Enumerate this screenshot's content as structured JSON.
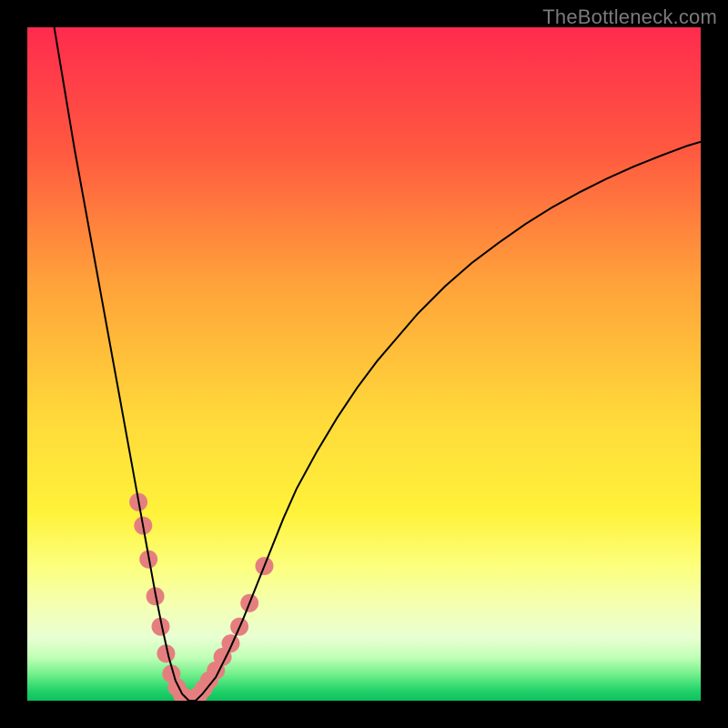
{
  "watermark": "TheBottleneck.com",
  "chart_data": {
    "type": "line",
    "title": "",
    "xlabel": "",
    "ylabel": "",
    "xlim": [
      0,
      100
    ],
    "ylim": [
      0,
      100
    ],
    "grid": false,
    "legend": false,
    "background_gradient_stops": [
      {
        "offset": 0.0,
        "color": "#ff2b4e"
      },
      {
        "offset": 0.18,
        "color": "#ff5840"
      },
      {
        "offset": 0.38,
        "color": "#ffa23a"
      },
      {
        "offset": 0.58,
        "color": "#ffd93a"
      },
      {
        "offset": 0.72,
        "color": "#fff23a"
      },
      {
        "offset": 0.8,
        "color": "#fcff7d"
      },
      {
        "offset": 0.86,
        "color": "#f4ffb3"
      },
      {
        "offset": 0.905,
        "color": "#e9ffd2"
      },
      {
        "offset": 0.935,
        "color": "#c3ffb8"
      },
      {
        "offset": 0.96,
        "color": "#74f08c"
      },
      {
        "offset": 0.985,
        "color": "#22d36a"
      },
      {
        "offset": 1.0,
        "color": "#0cc05e"
      }
    ],
    "series": [
      {
        "name": "bottleneck-curve",
        "color": "#000000",
        "stroke_width": 2,
        "x": [
          4,
          5,
          6,
          7,
          8,
          9,
          10,
          11,
          12,
          13,
          14,
          15,
          16,
          17,
          18,
          19,
          20,
          21,
          22,
          23,
          24,
          25,
          26,
          28,
          30,
          32,
          34,
          36,
          38,
          40,
          43,
          46,
          49,
          52,
          55,
          58,
          62,
          66,
          70,
          74,
          78,
          82,
          86,
          90,
          94,
          98,
          100
        ],
        "y": [
          100,
          94,
          88,
          82,
          76.5,
          71,
          65.5,
          60,
          54.5,
          49,
          43.5,
          38,
          32.5,
          27,
          21.5,
          16,
          11,
          6.5,
          3,
          1,
          0,
          0,
          1,
          3.5,
          7.5,
          12,
          17,
          22,
          27,
          31.5,
          37,
          42,
          46.5,
          50.5,
          54,
          57.5,
          61.5,
          65,
          68,
          70.8,
          73.3,
          75.5,
          77.5,
          79.3,
          80.9,
          82.4,
          83
        ]
      }
    ],
    "markers": {
      "name": "sample-points",
      "color": "#e57f7f",
      "radius": 10,
      "x": [
        16.5,
        17.2,
        18.0,
        19.0,
        19.8,
        20.6,
        21.4,
        22.2,
        23.0,
        23.8,
        24.6,
        25.4,
        26.2,
        27.0,
        28.0,
        29.0,
        30.2,
        31.5,
        33.0,
        35.2
      ],
      "y": [
        29.5,
        26.0,
        21.0,
        15.5,
        11.0,
        7.0,
        4.0,
        2.0,
        0.8,
        0.3,
        0.3,
        0.8,
        1.8,
        3.0,
        4.5,
        6.5,
        8.5,
        11.0,
        14.5,
        20.0
      ]
    }
  }
}
